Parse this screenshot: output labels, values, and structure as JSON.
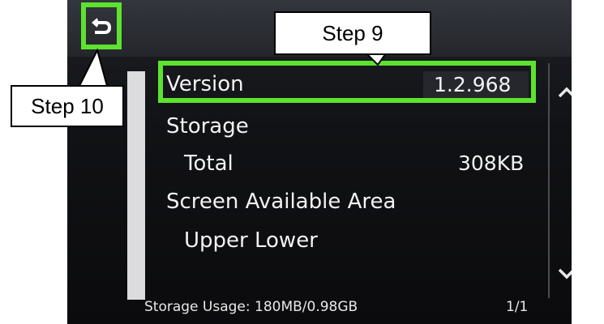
{
  "screen": {
    "rows": [
      {
        "label": "Version",
        "value": "1.2.968"
      },
      {
        "label": "Storage",
        "value": ""
      },
      {
        "label": "Total",
        "value": "308KB"
      },
      {
        "label": "Screen Available Area",
        "value": ""
      },
      {
        "label": "Upper Lower",
        "value": ""
      }
    ],
    "footer": {
      "storage_usage": "Storage Usage: 180MB/0.98GB",
      "page": "1/1"
    },
    "icons": {
      "back": "back-arrow-icon",
      "scroll_up": "chevron-up-icon",
      "scroll_down": "chevron-down-icon"
    }
  },
  "annotations": {
    "step9": "Step 9",
    "step10": "Step 10",
    "highlight_color": "#5de32e"
  }
}
